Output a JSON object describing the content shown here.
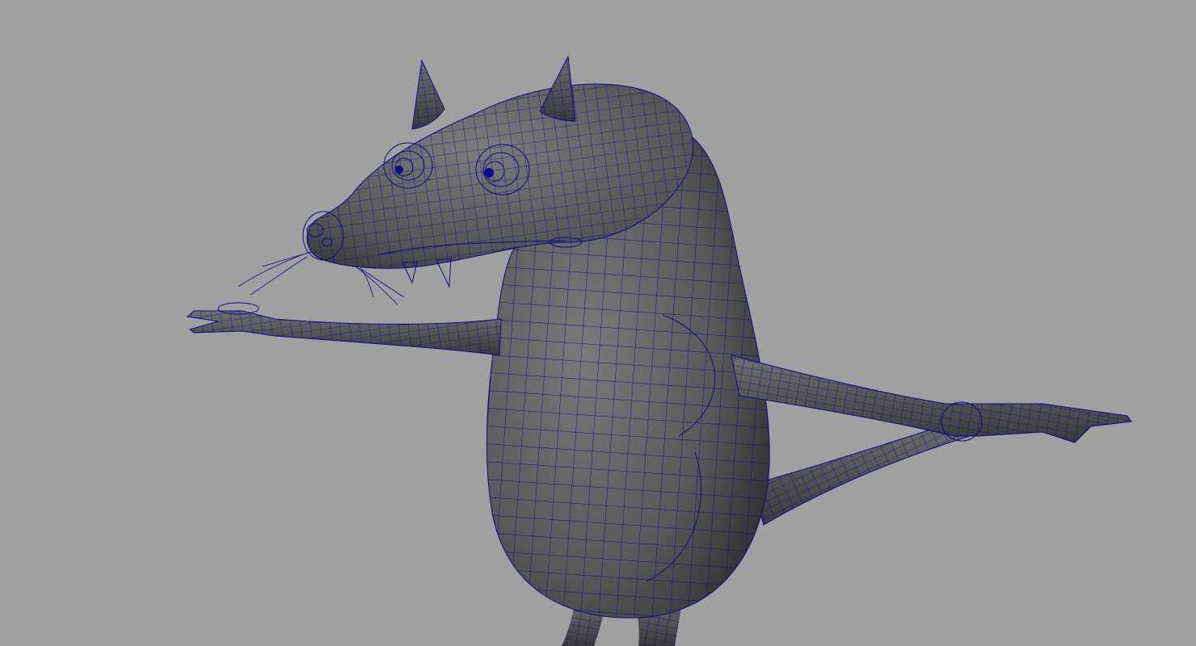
{
  "viewport": {
    "background_color": "#a0a0a0",
    "mesh_fill_color": "#5c5c5c",
    "wireframe_color": "#0a0a8c",
    "display_mode": "shaded-with-wireframe",
    "subject": "rat-character-mesh"
  }
}
